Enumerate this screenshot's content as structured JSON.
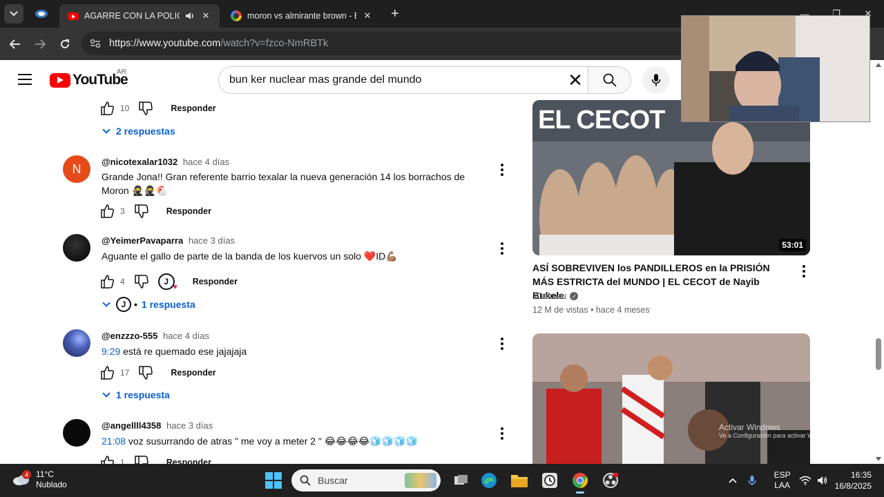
{
  "browser": {
    "tabs": [
      {
        "title": "AGARRE CON LA POLICÍA Y",
        "active": true
      },
      {
        "title": "moron vs almirante brown - Bu",
        "active": false
      }
    ],
    "close_glyph": "✕",
    "new_tab_glyph": "+",
    "url_host": "https://www.youtube.com",
    "url_path": "/watch?v=fzco-NmRBTk"
  },
  "youtube": {
    "logo_text": "YouTube",
    "region": "AR",
    "search_query": "bun ker nuclear mas grande del mundo"
  },
  "comments_top": {
    "likes": "10",
    "reply_label": "Responder",
    "replies_label": "2 respuestas"
  },
  "comments": [
    {
      "avatar_letter": "N",
      "avatar_color": "#e64a19",
      "author": "@nicotexalar1032",
      "time": "hace 4 días",
      "text": "Grande Jona!! Gran referente barrio texalar la nueva generación 14 los borrachos de Moron 🥷🥷🐔",
      "likes": "3",
      "reply_label": "Responder"
    },
    {
      "avatar_letter": "",
      "avatar_color": "#111111",
      "author": "@YeimerPavaparra",
      "time": "hace 3 días",
      "text": "Aguante el gallo de parte de la banda de los kuervos un solo ❤️ID💪🏽",
      "likes": "4",
      "reply_label": "Responder",
      "creator_heart_letter": "J",
      "replies_label": "1 respuesta"
    },
    {
      "avatar_letter": "",
      "avatar_color": "#3b4a8c",
      "author": "@enzzzo-555",
      "time": "hace 4 días",
      "timestamp": "9:29",
      "text": " está re quemado ese jajajaja",
      "likes": "17",
      "reply_label": "Responder",
      "replies_label": "1 respuesta"
    },
    {
      "avatar_letter": "",
      "avatar_color": "#0a0a0a",
      "author": "@angellll4358",
      "time": "hace 3 días",
      "timestamp": "21:08",
      "text": " voz susurrando de atras \" me voy a meter 2 \" 😂😂😂😂🧊🧊🧊🧊",
      "likes": "1",
      "reply_label": "Responder"
    }
  ],
  "related": [
    {
      "thumb_text": "EL CECOT",
      "duration": "53:01",
      "title": "ASÍ SOBREVIVEN los PANDILLEROS en la PRISIÓN MÁS ESTRICTA del MUNDO | EL CECOT de Nayib Bukele",
      "channel": "JDalmau",
      "views": "12 M de vistas",
      "age": "hace 4 meses"
    },
    {
      "thumb_text": "",
      "duration": ""
    }
  ],
  "watermark": {
    "line1": "Activar Windows",
    "line2": "Ve a Configuración para activar Windows."
  },
  "taskbar": {
    "weather_badge": "4",
    "temperature": "11°C",
    "weather_desc": "Nublado",
    "search_placeholder": "Buscar",
    "lang_top": "ESP",
    "lang_bottom": "LAA",
    "time": "16:35",
    "date": "16/8/2025"
  }
}
